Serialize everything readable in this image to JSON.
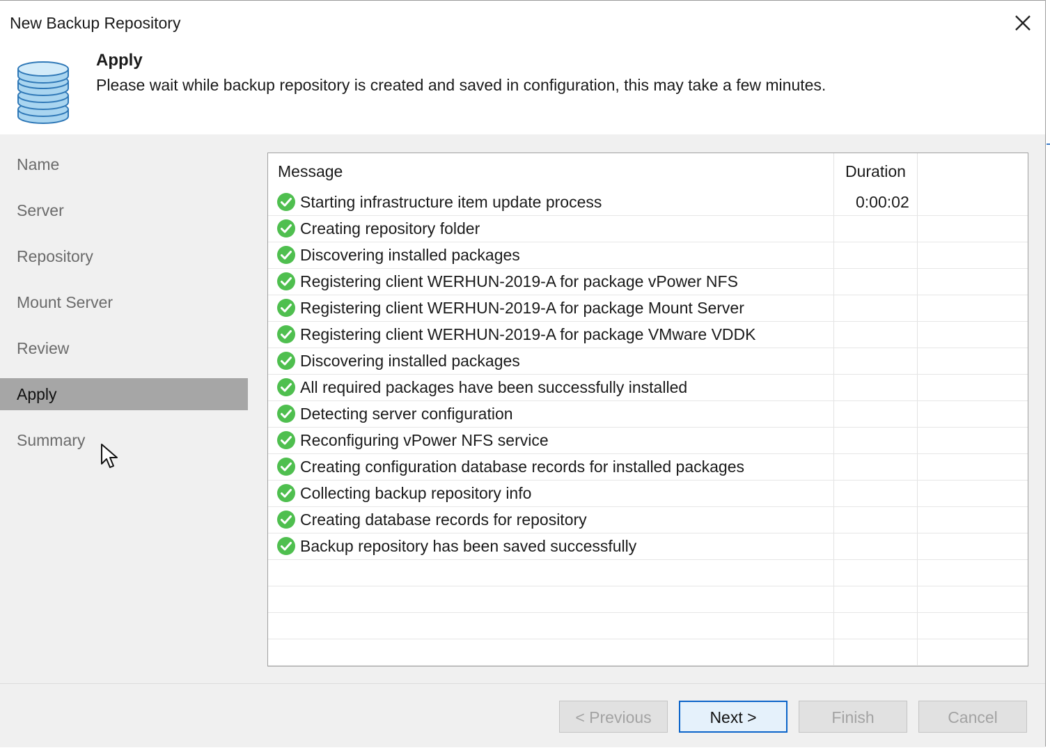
{
  "window": {
    "title": "New Backup Repository"
  },
  "header": {
    "step_title": "Apply",
    "step_description": "Please wait while backup repository is created and saved in configuration, this may take a few minutes."
  },
  "sidebar": {
    "items": [
      {
        "label": "Name",
        "active": false
      },
      {
        "label": "Server",
        "active": false
      },
      {
        "label": "Repository",
        "active": false
      },
      {
        "label": "Mount Server",
        "active": false
      },
      {
        "label": "Review",
        "active": false
      },
      {
        "label": "Apply",
        "active": true
      },
      {
        "label": "Summary",
        "active": false
      }
    ]
  },
  "log": {
    "columns": {
      "message": "Message",
      "duration": "Duration"
    },
    "rows": [
      {
        "status": "success",
        "message": "Starting infrastructure item update process",
        "duration": "0:00:02"
      },
      {
        "status": "success",
        "message": "Creating repository folder",
        "duration": ""
      },
      {
        "status": "success",
        "message": "Discovering installed packages",
        "duration": ""
      },
      {
        "status": "success",
        "message": "Registering client WERHUN-2019-A for package vPower NFS",
        "duration": ""
      },
      {
        "status": "success",
        "message": "Registering client WERHUN-2019-A for package Mount Server",
        "duration": ""
      },
      {
        "status": "success",
        "message": "Registering client WERHUN-2019-A for package VMware VDDK",
        "duration": ""
      },
      {
        "status": "success",
        "message": "Discovering installed packages",
        "duration": ""
      },
      {
        "status": "success",
        "message": "All required packages have been successfully installed",
        "duration": ""
      },
      {
        "status": "success",
        "message": "Detecting server configuration",
        "duration": ""
      },
      {
        "status": "success",
        "message": "Reconfiguring vPower NFS service",
        "duration": ""
      },
      {
        "status": "success",
        "message": "Creating configuration database records for installed packages",
        "duration": ""
      },
      {
        "status": "success",
        "message": "Collecting backup repository info",
        "duration": ""
      },
      {
        "status": "success",
        "message": "Creating database records for repository",
        "duration": ""
      },
      {
        "status": "success",
        "message": "Backup repository has been saved successfully",
        "duration": ""
      }
    ]
  },
  "buttons": {
    "previous": {
      "label": "< Previous",
      "enabled": false
    },
    "next": {
      "label": "Next >",
      "enabled": true
    },
    "finish": {
      "label": "Finish",
      "enabled": false
    },
    "cancel": {
      "label": "Cancel",
      "enabled": false
    }
  },
  "colors": {
    "success_icon": "#4fbf4f",
    "active_nav": "#a6a6a6",
    "db_icon": "#9fd0ee",
    "primary_border": "#0a63c9"
  },
  "icons": {
    "close": "close-icon",
    "header": "database-icon",
    "status": "check-circle-icon",
    "pointer": "mouse-cursor-icon"
  }
}
